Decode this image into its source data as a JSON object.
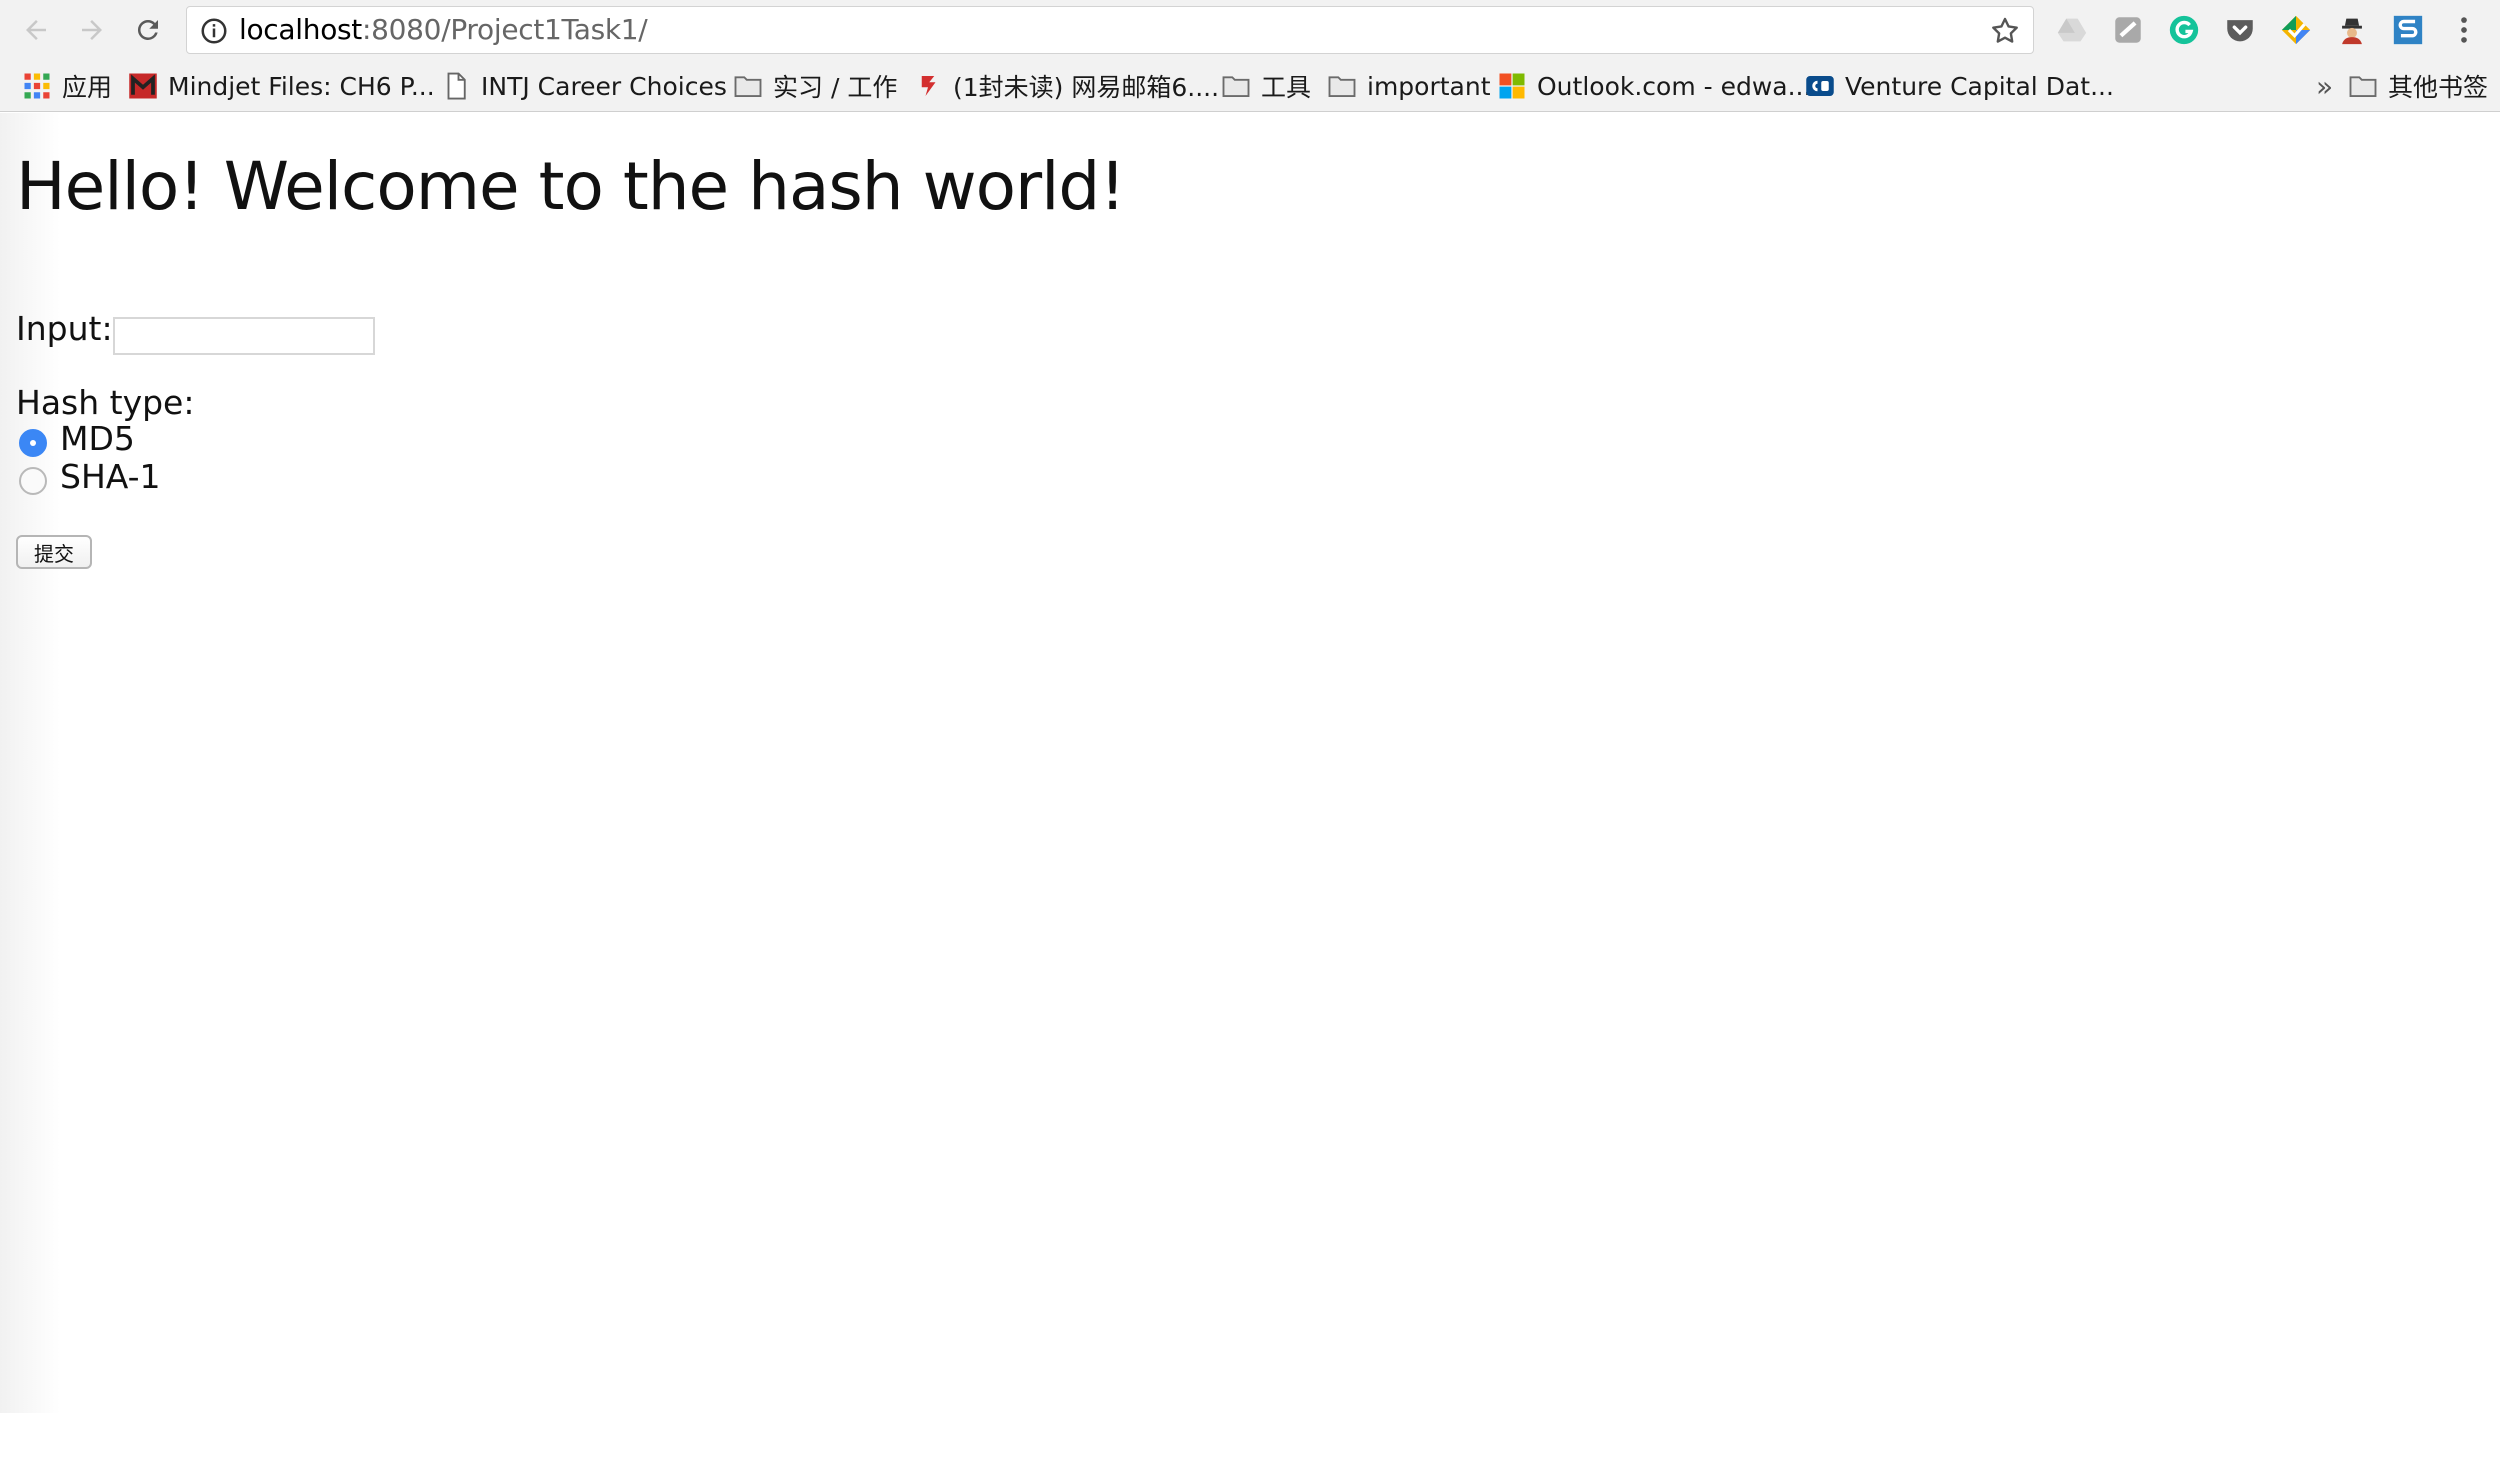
{
  "browser": {
    "url_host": "localhost",
    "url_path": ":8080/Project1Task1/",
    "extensions": [
      "drive-icon",
      "generic-extension-icon",
      "grammarly-icon",
      "pocket-icon",
      "color-picker-icon",
      "agent-icon",
      "s-extension-icon"
    ]
  },
  "bookmarks": {
    "apps": "应用",
    "items": [
      {
        "label": "Mindjet Files: CH6 P...",
        "icon": "mindjet-icon"
      },
      {
        "label": "INTJ Career Choices",
        "icon": "page-icon"
      },
      {
        "label": "实习 / 工作",
        "icon": "folder-icon"
      },
      {
        "label": "(1封未读) 网易邮箱6....",
        "icon": "netease-icon"
      },
      {
        "label": "工具",
        "icon": "folder-icon"
      },
      {
        "label": "important",
        "icon": "folder-icon"
      },
      {
        "label": "Outlook.com - edwa...",
        "icon": "microsoft-icon"
      },
      {
        "label": "Venture Capital Dat...",
        "icon": "cb-icon"
      }
    ],
    "overflow": "»",
    "other": "其他书签"
  },
  "page": {
    "title": "Hello! Welcome to the hash world!",
    "input_label": "Input:",
    "input_value": "",
    "hash_type_label": "Hash type:",
    "options": [
      {
        "label": "MD5",
        "checked": true
      },
      {
        "label": "SHA-1",
        "checked": false
      }
    ],
    "submit_label": "提交"
  }
}
